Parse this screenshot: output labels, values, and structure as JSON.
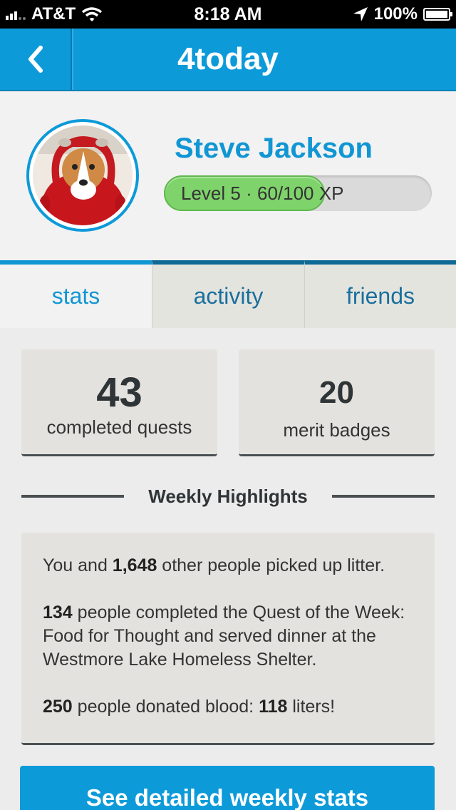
{
  "status_bar": {
    "carrier": "AT&T",
    "time": "8:18 AM",
    "battery": "100%",
    "battery_level": 1.0
  },
  "nav": {
    "title": "4today",
    "back_icon": "chevron-left-icon"
  },
  "profile": {
    "name": "Steve Jackson",
    "level_label": "Level 5",
    "separator": "·",
    "xp_label": "60/100 XP",
    "xp_current": 60,
    "xp_max": 100
  },
  "tabs": [
    {
      "label": "stats",
      "active": true
    },
    {
      "label": "activity",
      "active": false
    },
    {
      "label": "friends",
      "active": false
    }
  ],
  "stats": [
    {
      "value": "43",
      "label": "completed quests"
    },
    {
      "value": "20",
      "label": "merit badges"
    }
  ],
  "highlights": {
    "heading": "Weekly Highlights",
    "items": [
      {
        "pre": "You and ",
        "b1": "1,648",
        "mid": " other people picked up litter.",
        "b2": "",
        "post": ""
      },
      {
        "pre": "",
        "b1": "134",
        "mid": " people completed the Quest of the Week: Food for Thought and served dinner at the Westmore Lake Homeless Shelter.",
        "b2": "",
        "post": ""
      },
      {
        "pre": "",
        "b1": "250",
        "mid": " people donated blood: ",
        "b2": "118",
        "post": " liters!"
      }
    ]
  },
  "cta": {
    "label": "See detailed weekly stats"
  },
  "colors": {
    "primary": "#0d9ad9",
    "xp_green": "#7ed36b",
    "card_bg": "#e3e2de",
    "dark_text": "#2f3437"
  }
}
